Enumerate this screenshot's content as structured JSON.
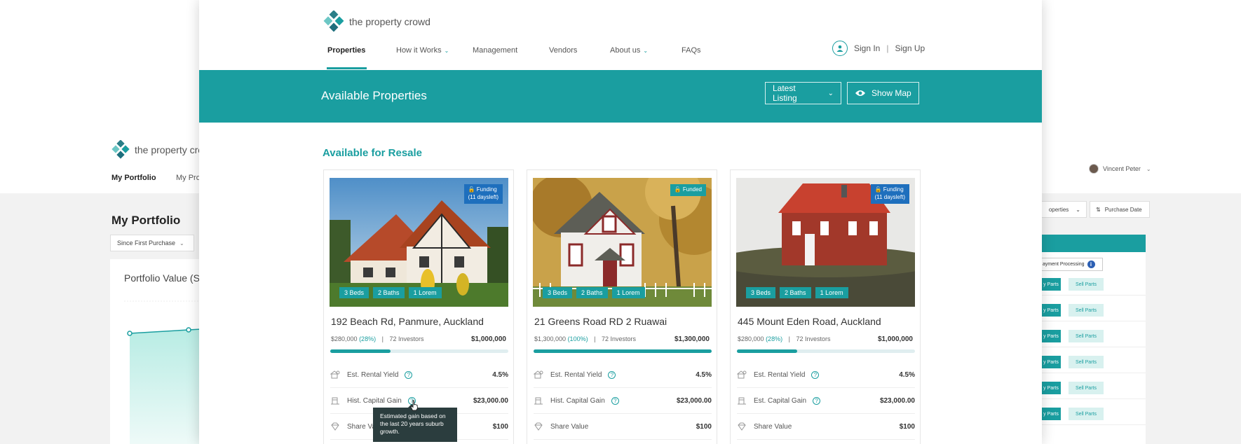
{
  "background": {
    "logo_text": "the property cro",
    "nav": {
      "item1": "My Portfolio",
      "item2": "My Pro"
    },
    "heading": "My Portfolio",
    "since_select": "Since First Purchase",
    "chart_title": "Portfolio Value (S",
    "user_name": "Vincent Peter",
    "filter_properties": "operties",
    "filter_purchase_date": "Purchase Date",
    "status_label": "ayment Processing",
    "buy_label": "y Parts",
    "sell_label": "Sell Parts"
  },
  "header": {
    "logo_text": "the property crowd",
    "nav": [
      {
        "label": "Properties"
      },
      {
        "label": "How it Works"
      },
      {
        "label": "Management"
      },
      {
        "label": "Vendors"
      },
      {
        "label": "About us"
      },
      {
        "label": "FAQs"
      }
    ],
    "sign_in": "Sign In",
    "separator": "|",
    "sign_up": "Sign Up"
  },
  "banner": {
    "title": "Available Properties",
    "sort_label": "Latest Listing",
    "map_label": "Show Map"
  },
  "section_title": "Available for Resale",
  "colors": {
    "accent": "#1a9ea0",
    "funding_badge": "#1e6fbd"
  },
  "cards": [
    {
      "status_line1": "Funding",
      "status_line2": "(11 daysleft)",
      "tags": [
        "3 Beds",
        "2 Baths",
        "1 Lorem"
      ],
      "title": "192 Beach Rd, Panmure, Auckland",
      "raised": "$280,000",
      "pct": "(28%)",
      "investors": "72 Investors",
      "target": "$1,000,000",
      "progress": 0.34,
      "stats": [
        {
          "label": "Est. Rental Yield",
          "value": "4.5%"
        },
        {
          "label": "Hist. Capital Gain",
          "value": "$23,000.00"
        },
        {
          "label": "Share Value",
          "value": "$100"
        }
      ]
    },
    {
      "status_line1": "Funded",
      "tags": [
        "3 Beds",
        "2 Baths",
        "1 Lorem"
      ],
      "title": "21 Greens Road RD 2 Ruawai",
      "raised": "$1,300,000",
      "pct": "(100%)",
      "investors": "72 Investors",
      "target": "$1,300,000",
      "progress": 1.0,
      "stats": [
        {
          "label": "Est. Rental Yield",
          "value": "4.5%"
        },
        {
          "label": "Hist. Capital Gain",
          "value": "$23,000.00"
        },
        {
          "label": "Share Value",
          "value": "$100"
        }
      ]
    },
    {
      "status_line1": "Funding",
      "status_line2": "(11 daysleft)",
      "tags": [
        "3 Beds",
        "2 Baths",
        "1 Lorem"
      ],
      "title": "445 Mount Eden Road, Auckland",
      "raised": "$280,000",
      "pct": "(28%)",
      "investors": "72 Investors",
      "target": "$1,000,000",
      "progress": 0.34,
      "stats": [
        {
          "label": "Est. Rental Yield",
          "value": "4.5%"
        },
        {
          "label": "Est. Capital Gain",
          "value": "$23,000.00"
        },
        {
          "label": "Share Value",
          "value": "$100"
        }
      ]
    }
  ],
  "tooltip": {
    "text": "Estimated gain based on the last 20 years suburb growth."
  }
}
